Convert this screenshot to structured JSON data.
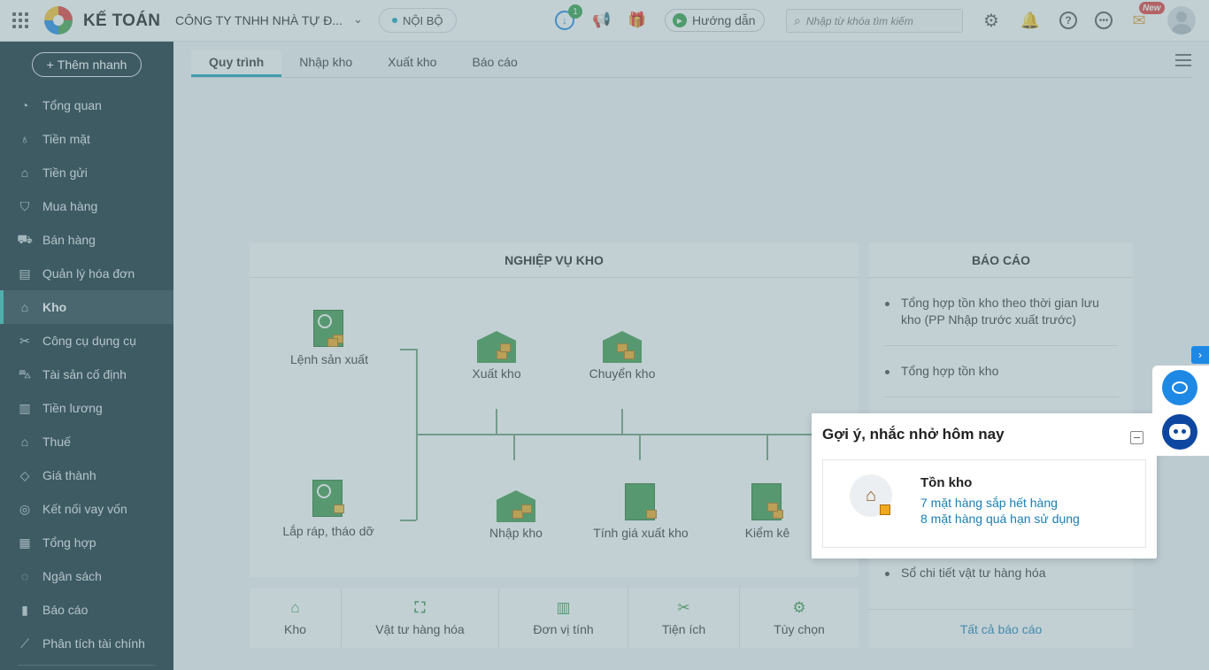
{
  "header": {
    "brand": "KẾ TOÁN",
    "company": "CÔNG TY TNHH NHÀ TỰ Đ...",
    "scope": "NỘI BỘ",
    "download_badge": "1",
    "guide_label": "Hướng dẫn",
    "search_placeholder": "Nhập từ khóa tìm kiếm",
    "new_badge": "New"
  },
  "sidebar": {
    "quick_add": "Thêm nhanh",
    "items": [
      {
        "label": "Tổng quan",
        "icon": "pie-chart-icon"
      },
      {
        "label": "Tiền mặt",
        "icon": "money-bag-icon"
      },
      {
        "label": "Tiền gửi",
        "icon": "bank-icon"
      },
      {
        "label": "Mua hàng",
        "icon": "shopping-bag-icon"
      },
      {
        "label": "Bán hàng",
        "icon": "cart-icon"
      },
      {
        "label": "Quản lý hóa đơn",
        "icon": "invoice-icon"
      },
      {
        "label": "Kho",
        "icon": "warehouse-icon"
      },
      {
        "label": "Công cụ dụng cụ",
        "icon": "tools-icon"
      },
      {
        "label": "Tài sản cố định",
        "icon": "car-icon"
      },
      {
        "label": "Tiền lương",
        "icon": "payroll-icon"
      },
      {
        "label": "Thuế",
        "icon": "tax-icon"
      },
      {
        "label": "Giá thành",
        "icon": "price-tag-icon"
      },
      {
        "label": "Kết nối vay vốn",
        "icon": "loan-icon"
      },
      {
        "label": "Tổng hợp",
        "icon": "summary-icon"
      },
      {
        "label": "Ngân sách",
        "icon": "budget-icon"
      },
      {
        "label": "Báo cáo",
        "icon": "bar-chart-icon"
      },
      {
        "label": "Phân tích tài chính",
        "icon": "line-chart-icon"
      }
    ],
    "active_index": 6
  },
  "tabs": [
    "Quy trình",
    "Nhập kho",
    "Xuất kho",
    "Báo cáo"
  ],
  "workflow": {
    "title": "NGHIỆP VỤ KHO",
    "nodes": {
      "production_order": "Lệnh sản xuất",
      "stock_out": "Xuất kho",
      "transfer": "Chuyển kho",
      "assembly": "Lắp ráp, tháo dỡ",
      "stock_in": "Nhập kho",
      "cost_calc": "Tính giá xuất kho",
      "inventory_check": "Kiểm kê"
    }
  },
  "bottom_bar": [
    "Kho",
    "Vật tư hàng hóa",
    "Đơn vị tính",
    "Tiện ích",
    "Tùy chọn"
  ],
  "reports": {
    "title": "BÁO CÁO",
    "items": [
      "Tổng hợp tồn kho theo thời gian lưu kho (PP Nhập trước xuất trước)",
      "Tổng hợp tồn kho",
      "Sổ chi tiết vật tư hàng hóa"
    ],
    "all_link": "Tất cả báo cáo"
  },
  "suggestion": {
    "title": "Gợi ý, nhắc nhở hôm nay",
    "card_title": "Tồn kho",
    "link_low_stock": "7 mặt hàng sắp hết hàng",
    "link_expired": "8 mặt hàng quá hạn sử dụng"
  },
  "colors": {
    "sidebar_bg": "#0f2a33",
    "accent": "#17a2b8",
    "warehouse_green": "#3e9a4a",
    "link_blue": "#1a7fb5"
  }
}
